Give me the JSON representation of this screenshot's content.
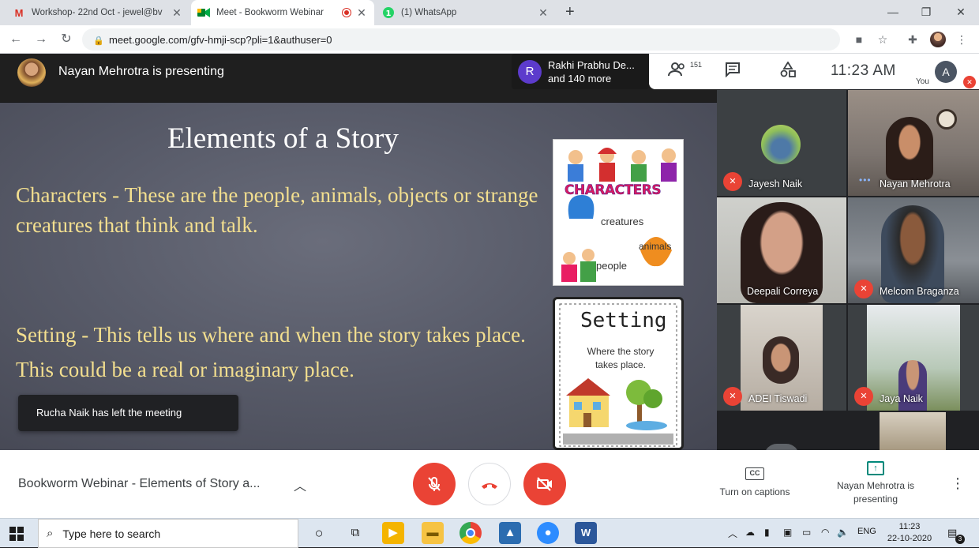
{
  "browser": {
    "tabs": [
      {
        "title": "Workshop- 22nd Oct - jewel@bv",
        "icon": "gmail-icon",
        "color": "#d93025"
      },
      {
        "title": "Meet - Bookworm Webinar",
        "icon": "meet-icon",
        "color": "#00897b"
      },
      {
        "title": "(1) WhatsApp",
        "icon": "whatsapp-icon",
        "color": "#25d366"
      }
    ],
    "url": "meet.google.com/gfv-hmji-scp?pli=1&authuser=0"
  },
  "meet": {
    "presenter_text": "Nayan Mehrotra is presenting",
    "chip_line1": "Rakhi Prabhu De...",
    "chip_line2": "and 140 more",
    "chip_initial": "R",
    "participant_count": "151",
    "time": "11:23 AM",
    "you_label": "You",
    "you_initial": "A",
    "toast": "Rucha Naik has left the meeting",
    "meeting_title": "Bookworm Webinar - Elements of Story a...",
    "captions_label": "Turn on captions",
    "presenting_label": "Nayan Mehrotra is presenting"
  },
  "slide": {
    "title": "Elements of a Story",
    "characters_text": "Characters - These are the people, animals, objects or strange creatures that think and talk.",
    "setting_text": "Setting - This tells us where and when the story takes place.  This could be a real or imaginary place.",
    "card1": {
      "heading": "CHARACTERS",
      "w1": "creatures",
      "w2": "animals",
      "w3": "people"
    },
    "card2": {
      "heading": "Setting",
      "sub": "Where the story takes place."
    }
  },
  "participants": [
    {
      "name": "Jayesh Naik",
      "muted": true
    },
    {
      "name": "Nayan Mehrotra",
      "muted": false
    },
    {
      "name": "Deepali Correya",
      "muted": false
    },
    {
      "name": "Melcom Braganza",
      "muted": true
    },
    {
      "name": "ADEI Tiswadi",
      "muted": true
    },
    {
      "name": "Jaya Naik",
      "muted": true
    }
  ],
  "taskbar": {
    "search_placeholder": "Type here to search",
    "lang": "ENG",
    "time": "11:23",
    "date": "22-10-2020",
    "notifications": "3"
  },
  "colors": {
    "accent_red": "#ea4335",
    "slide_text": "#f3df8f",
    "meet_dark": "#202124"
  }
}
